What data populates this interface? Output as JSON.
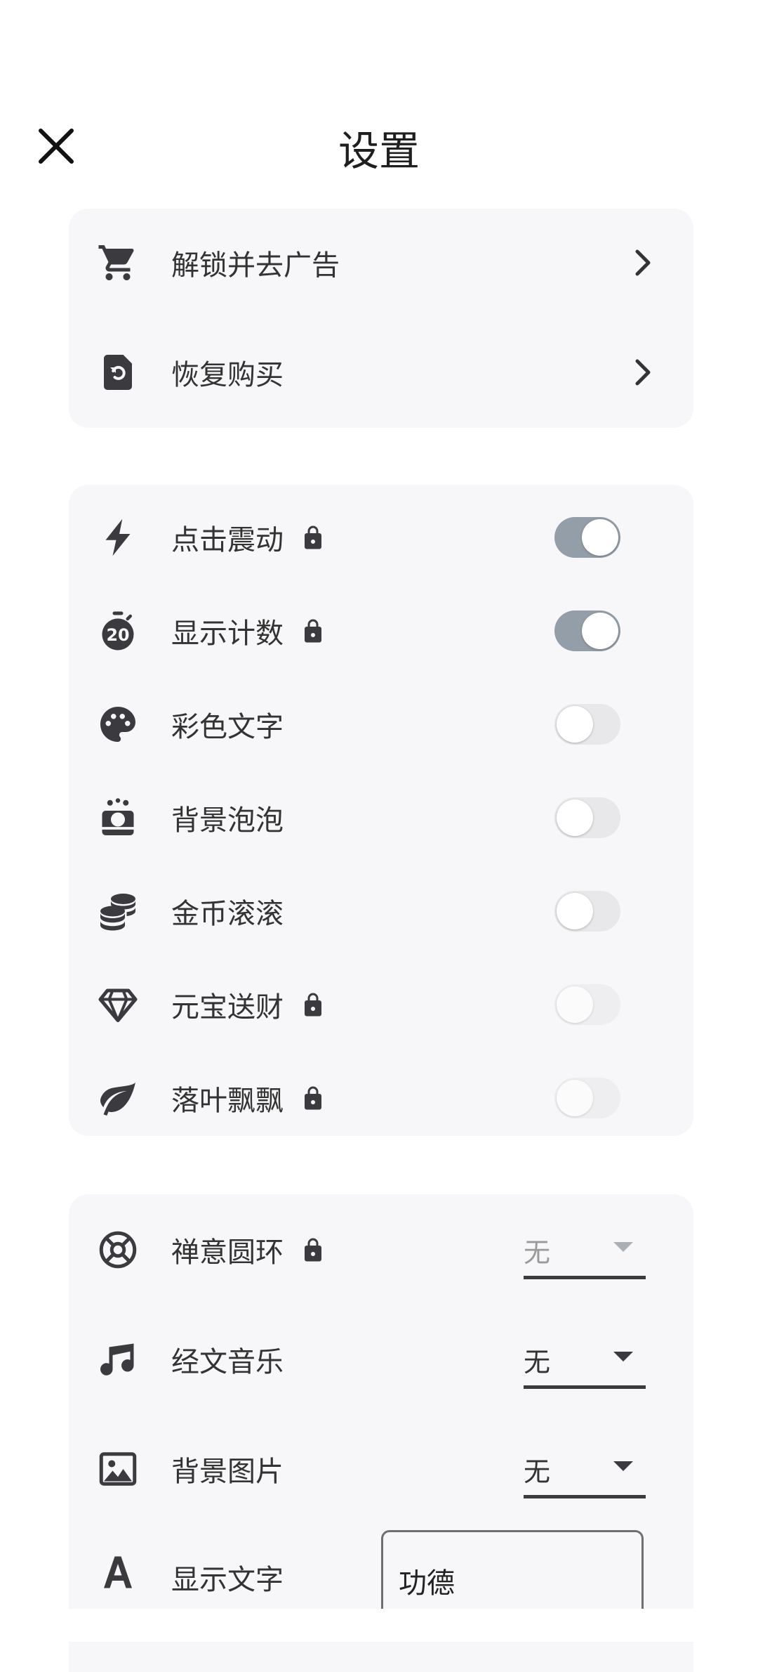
{
  "header": {
    "title": "设置"
  },
  "purchase": {
    "items": [
      {
        "label": "解锁并去广告",
        "icon": "cart-icon"
      },
      {
        "label": "恢复购买",
        "icon": "restore-file-icon"
      }
    ]
  },
  "effects": {
    "items": [
      {
        "label": "点击震动",
        "icon": "bolt-icon",
        "locked": true,
        "on": true
      },
      {
        "label": "显示计数",
        "icon": "timer-20-icon",
        "locked": true,
        "on": true
      },
      {
        "label": "彩色文字",
        "icon": "palette-icon",
        "locked": false,
        "on": false
      },
      {
        "label": "背景泡泡",
        "icon": "bubbles-icon",
        "locked": false,
        "on": false
      },
      {
        "label": "金币滚滚",
        "icon": "coins-icon",
        "locked": false,
        "on": false
      },
      {
        "label": "元宝送财",
        "icon": "diamond-icon",
        "locked": true,
        "on": false
      },
      {
        "label": "落叶飘飘",
        "icon": "leaf-icon",
        "locked": true,
        "on": false
      }
    ]
  },
  "options": {
    "items": [
      {
        "label": "禅意圆环",
        "icon": "ring-icon",
        "locked": true,
        "value": "无"
      },
      {
        "label": "经文音乐",
        "icon": "music-note-icon",
        "locked": false,
        "value": "无"
      },
      {
        "label": "背景图片",
        "icon": "image-icon",
        "locked": false,
        "value": "无"
      }
    ],
    "text": {
      "label": "显示文字",
      "icon": "font-icon",
      "value": "功德"
    }
  },
  "colors": {
    "card": "#f7f7f9",
    "toggle_on": "#939ea8",
    "icon": "#3a3a3f"
  }
}
